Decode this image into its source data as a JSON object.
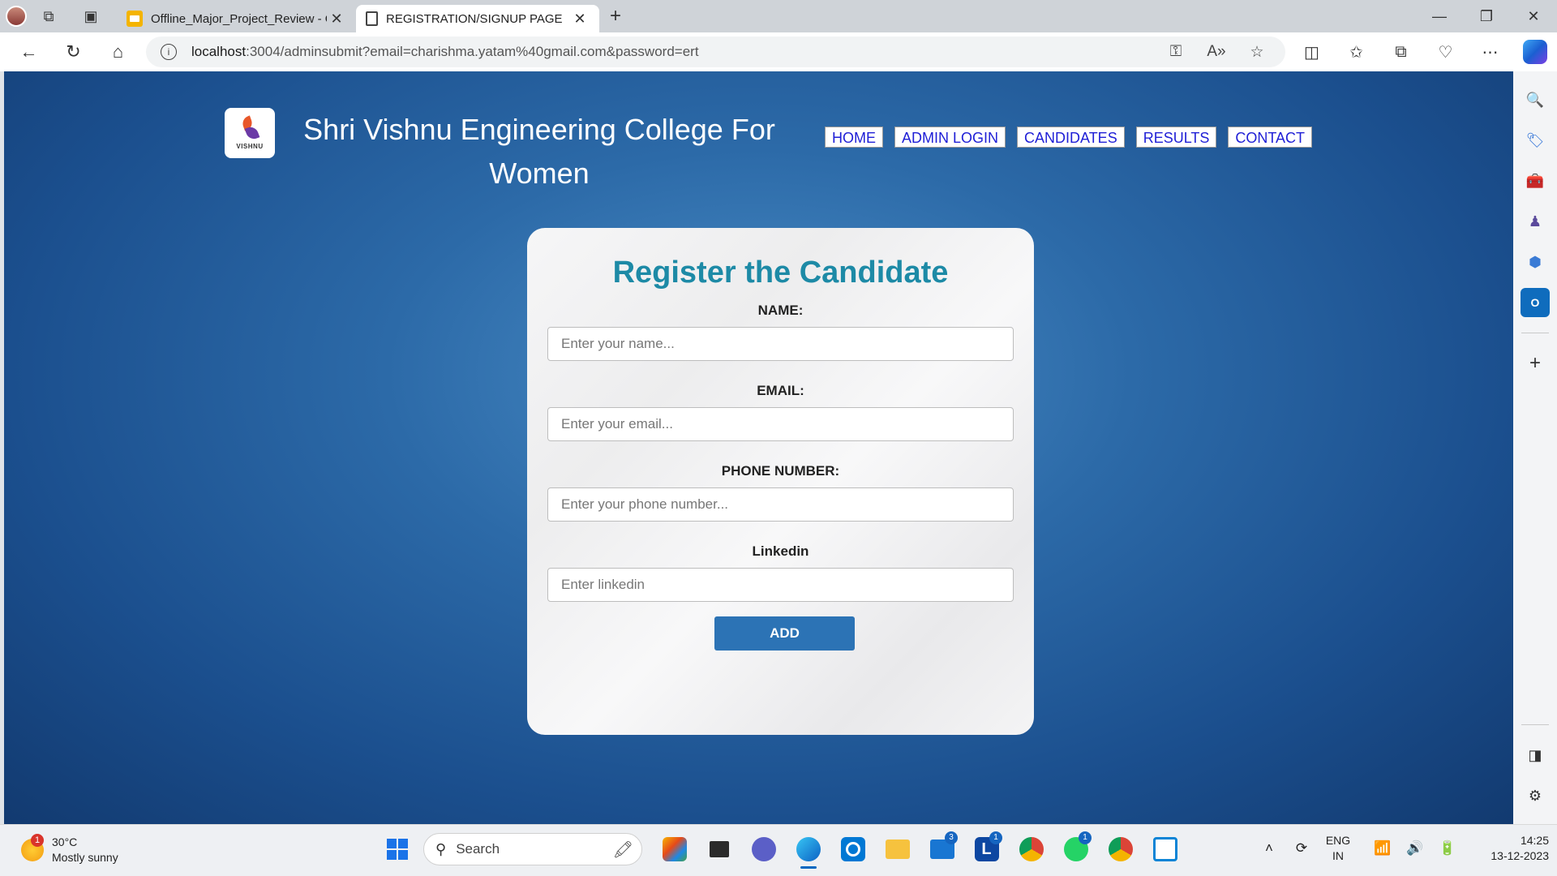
{
  "browser": {
    "tabs": [
      {
        "title": "Offline_Major_Project_Review - G",
        "active": false
      },
      {
        "title": "REGISTRATION/SIGNUP PAGE",
        "active": true
      }
    ],
    "url_host": "localhost",
    "url_rest": ":3004/adminsubmit?email=charishma.yatam%40gmail.com&password=ert"
  },
  "site": {
    "logo_text": "VISHNU",
    "title": "Shri Vishnu Engineering College For Women",
    "menu": [
      "HOME",
      "ADMIN LOGIN",
      "CANDIDATES",
      "RESULTS",
      "CONTACT"
    ]
  },
  "form": {
    "heading": "Register the Candidate",
    "fields": [
      {
        "label": "NAME:",
        "placeholder": "Enter your name..."
      },
      {
        "label": "EMAIL:",
        "placeholder": "Enter your email..."
      },
      {
        "label": "PHONE NUMBER:",
        "placeholder": "Enter your phone number..."
      },
      {
        "label": "Linkedin",
        "placeholder": "Enter linkedin"
      }
    ],
    "submit_label": "ADD"
  },
  "taskbar": {
    "weather_badge": "1",
    "temperature": "30°C",
    "condition": "Mostly sunny",
    "search_label": "Search",
    "mail_badge": "3",
    "l_app_label": "L",
    "l_app_badge": "1",
    "whatsapp_badge": "1",
    "lang_top": "ENG",
    "lang_bottom": "IN",
    "time": "14:25",
    "date": "13-12-2023"
  },
  "colors": {
    "heading": "#1d8aa6",
    "button": "#2c73b5",
    "menu_link": "#1f1fd6"
  }
}
